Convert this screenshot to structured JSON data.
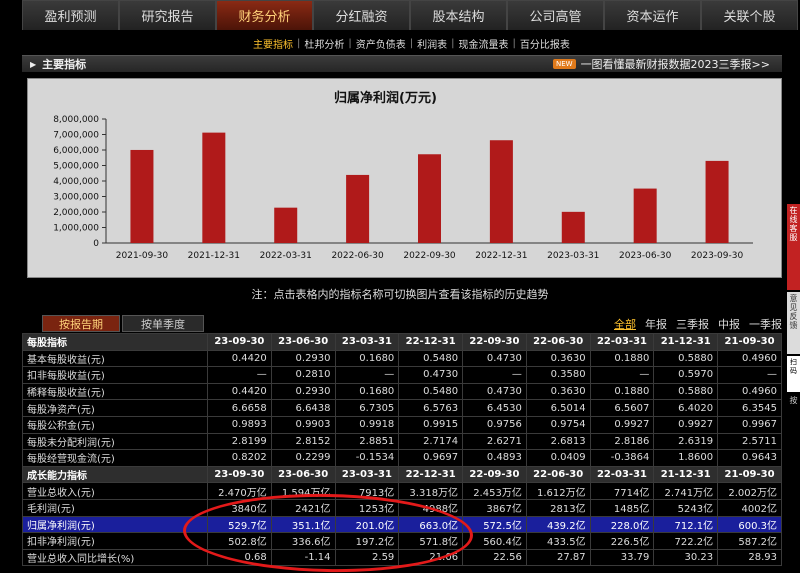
{
  "nav": {
    "tabs": [
      "盈利预测",
      "研究报告",
      "财务分析",
      "分红融资",
      "股本结构",
      "公司高管",
      "资本运作",
      "关联个股"
    ],
    "active": 2
  },
  "subnav": {
    "items": [
      "主要指标",
      "杜邦分析",
      "资产负债表",
      "利润表",
      "现金流量表",
      "百分比报表"
    ],
    "active": 0,
    "sep": "|"
  },
  "section": {
    "title": "主要指标",
    "promo_badge": "NEW",
    "promo_text": "一图看懂最新财报数据2023三季报>>"
  },
  "chart_data": {
    "type": "bar",
    "title": "归属净利润(万元)",
    "categories": [
      "2021-09-30",
      "2021-12-31",
      "2022-03-31",
      "2022-06-30",
      "2022-09-30",
      "2022-12-31",
      "2023-03-31",
      "2023-06-30",
      "2023-09-30"
    ],
    "values": [
      6003000,
      7121000,
      2280000,
      4392000,
      5725000,
      6630000,
      2010000,
      3511000,
      5297000
    ],
    "yticks": [
      "0",
      "1,000,000",
      "2,000,000",
      "3,000,000",
      "4,000,000",
      "5,000,000",
      "6,000,000",
      "7,000,000",
      "8,000,000"
    ],
    "ylim": [
      0,
      8000000
    ],
    "bar_color": "#b01a1a"
  },
  "note": "注：点击表格内的指标名称可切换图片查看该指标的历史趋势",
  "toolbar": {
    "btn_report": "按报告期",
    "btn_quarter": "按单季度",
    "periods": [
      "全部",
      "年报",
      "三季报",
      "中报",
      "一季报"
    ],
    "active_period": 0
  },
  "table": {
    "rows": [
      {
        "type": "head",
        "label": "每股指标",
        "cells": [
          "23-09-30",
          "23-06-30",
          "23-03-31",
          "22-12-31",
          "22-09-30",
          "22-06-30",
          "22-03-31",
          "21-12-31",
          "21-09-30"
        ]
      },
      {
        "label": "基本每股收益(元)",
        "cells": [
          "0.4420",
          "0.2930",
          "0.1680",
          "0.5480",
          "0.4730",
          "0.3630",
          "0.1880",
          "0.5880",
          "0.4960"
        ]
      },
      {
        "label": "扣非每股收益(元)",
        "cells": [
          "—",
          "0.2810",
          "—",
          "0.4730",
          "—",
          "0.3580",
          "—",
          "0.5970",
          "—"
        ]
      },
      {
        "label": "稀释每股收益(元)",
        "cells": [
          "0.4420",
          "0.2930",
          "0.1680",
          "0.5480",
          "0.4730",
          "0.3630",
          "0.1880",
          "0.5880",
          "0.4960"
        ]
      },
      {
        "label": "每股净资产(元)",
        "cells": [
          "6.6658",
          "6.6438",
          "6.7305",
          "6.5763",
          "6.4530",
          "6.5014",
          "6.5607",
          "6.4020",
          "6.3545"
        ]
      },
      {
        "label": "每股公积金(元)",
        "cells": [
          "0.9893",
          "0.9903",
          "0.9918",
          "0.9915",
          "0.9756",
          "0.9754",
          "0.9927",
          "0.9927",
          "0.9967"
        ]
      },
      {
        "label": "每股未分配利润(元)",
        "cells": [
          "2.8199",
          "2.8152",
          "2.8851",
          "2.7174",
          "2.6271",
          "2.6813",
          "2.8186",
          "2.6319",
          "2.5711"
        ]
      },
      {
        "label": "每股经营现金流(元)",
        "cells": [
          "0.8202",
          "0.2299",
          "-0.1534",
          "0.9697",
          "0.4893",
          "0.0409",
          "-0.3864",
          "1.8600",
          "0.9643"
        ]
      },
      {
        "type": "head",
        "label": "成长能力指标",
        "cells": [
          "23-09-30",
          "23-06-30",
          "23-03-31",
          "22-12-31",
          "22-09-30",
          "22-06-30",
          "22-03-31",
          "21-12-31",
          "21-09-30"
        ]
      },
      {
        "label": "营业总收入(元)",
        "cells": [
          "2.470万亿",
          "1.594万亿",
          "7913亿",
          "3.318万亿",
          "2.453万亿",
          "1.612万亿",
          "7714亿",
          "2.741万亿",
          "2.002万亿"
        ]
      },
      {
        "label": "毛利润(元)",
        "cells": [
          "3840亿",
          "2421亿",
          "1253亿",
          "4988亿",
          "3867亿",
          "2813亿",
          "1485亿",
          "5243亿",
          "4002亿"
        ]
      },
      {
        "type": "hl",
        "label": "归属净利润(元)",
        "cells": [
          "529.7亿",
          "351.1亿",
          "201.0亿",
          "663.0亿",
          "572.5亿",
          "439.2亿",
          "228.0亿",
          "712.1亿",
          "600.3亿"
        ]
      },
      {
        "label": "扣非净利润(元)",
        "cells": [
          "502.8亿",
          "336.6亿",
          "197.2亿",
          "571.8亿",
          "560.4亿",
          "433.5亿",
          "226.5亿",
          "722.2亿",
          "587.2亿"
        ]
      },
      {
        "label": "营业总收入同比增长(%)",
        "cells": [
          "0.68",
          "-1.14",
          "2.59",
          "21.06",
          "22.56",
          "27.87",
          "33.79",
          "30.23",
          "28.93"
        ]
      }
    ]
  },
  "side": {
    "red": "在线客服",
    "gray": "意见反馈",
    "qr": "扫码",
    "txt": "按"
  }
}
